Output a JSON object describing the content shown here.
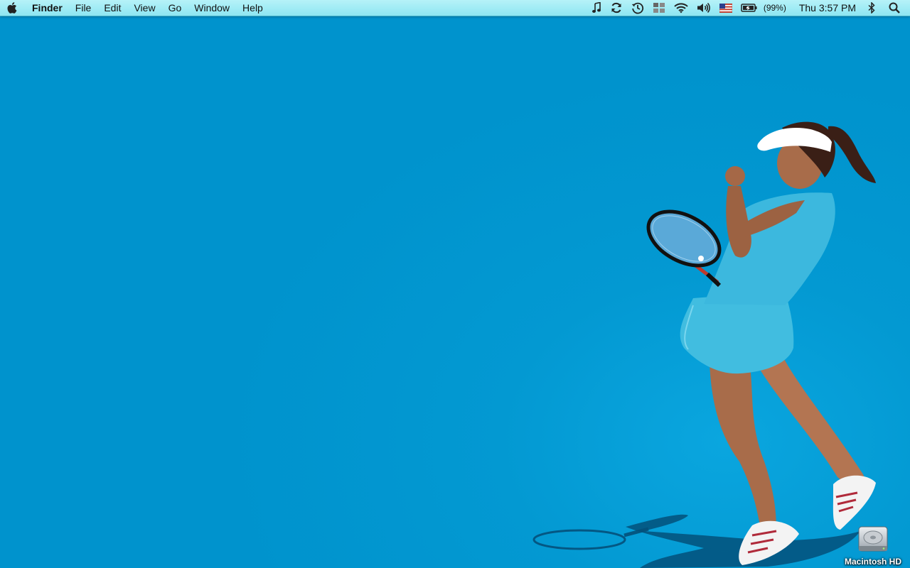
{
  "menubar": {
    "app_name": "Finder",
    "menus": [
      "File",
      "Edit",
      "View",
      "Go",
      "Window",
      "Help"
    ],
    "status_icons": [
      "music-note-icon",
      "sync-icon",
      "time-machine-icon",
      "spaces-icon",
      "wifi-icon",
      "volume-icon",
      "us-flag-icon",
      "battery-icon"
    ],
    "battery_percent": "(99%)",
    "clock": "Thu 3:57 PM"
  },
  "desktop": {
    "wallpaper_color": "#0095cf",
    "icons": [
      {
        "label": "Macintosh HD",
        "icon": "hard-drive-icon"
      }
    ]
  }
}
